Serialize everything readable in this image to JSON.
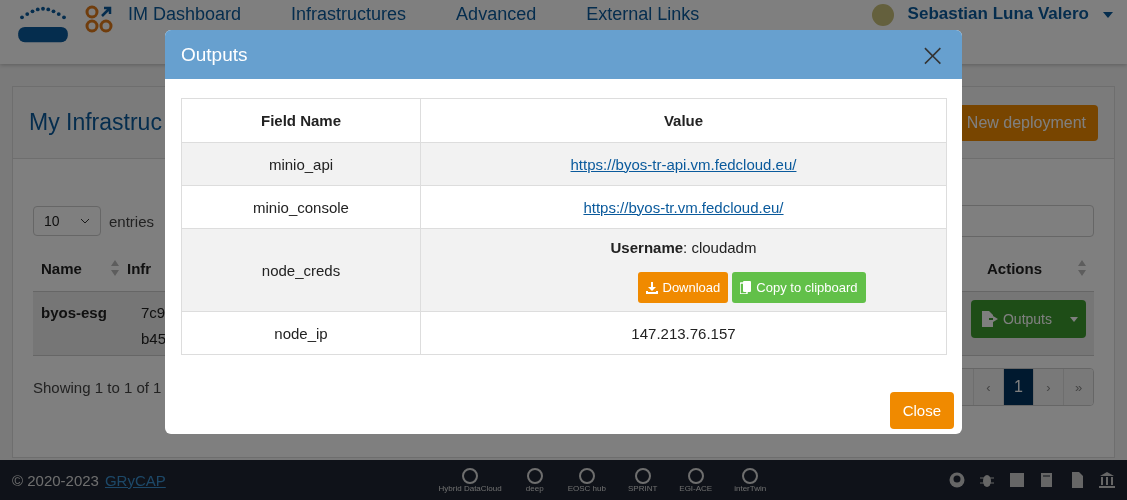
{
  "header": {
    "app_name": "IM Dashboard",
    "nav": [
      "Infrastructures",
      "Advanced",
      "External Links"
    ],
    "user": "Sebastian Luna Valero"
  },
  "card": {
    "title": "My Infrastruc",
    "new_button": "New deployment"
  },
  "table_controls": {
    "page_size": "10",
    "entries_label": "entries"
  },
  "table": {
    "columns": [
      "Name",
      "Infr",
      "Actions"
    ],
    "rows": [
      {
        "name": "byos-esg",
        "id_lines": [
          "7c9",
          "b45"
        ],
        "action": "Outputs"
      }
    ]
  },
  "info": "Showing 1 to 1 of 1",
  "pagination": [
    {
      "label": "‹",
      "selected": false
    },
    {
      "label": "1",
      "selected": true
    },
    {
      "label": "›",
      "selected": false
    },
    {
      "label": "»",
      "selected": false
    }
  ],
  "modal": {
    "title": "Outputs",
    "close_icon": "×",
    "columns": [
      "Field Name",
      "Value"
    ],
    "rows": [
      {
        "field": "minio_api",
        "kind": "link",
        "value": "https://byos-tr-api.vm.fedcloud.eu/"
      },
      {
        "field": "minio_console",
        "kind": "link",
        "value": "https://byos-tr.vm.fedcloud.eu/"
      },
      {
        "field": "node_creds",
        "kind": "creds",
        "value": "**Username**: cloudadm",
        "buttons": [
          "Download",
          "Copy to clipboard"
        ]
      },
      {
        "field": "node_ip",
        "kind": "text",
        "value": "147.213.76.157"
      }
    ],
    "close_button": "Close"
  },
  "footer": {
    "copyright": "© 2020-2023",
    "link": "GRyCAP",
    "logos": [
      "Hybrid DataCloud",
      "deep",
      "EOSC hub",
      "SPRINT",
      "EGI-ACE",
      "interTwin"
    ]
  }
}
